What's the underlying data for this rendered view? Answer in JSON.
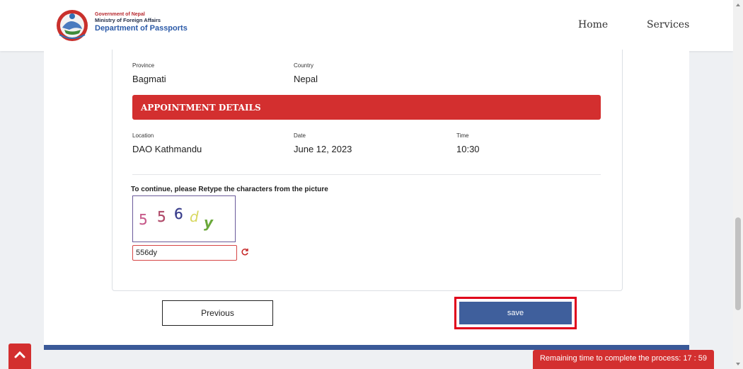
{
  "header": {
    "org_line1": "Government of Nepal",
    "org_line2": "Ministry of Foreign Affairs",
    "org_line3": "Department of Passports",
    "nav": [
      {
        "label": "Home"
      },
      {
        "label": "Services"
      }
    ]
  },
  "address": {
    "province_label": "Province",
    "province_value": "Bagmati",
    "country_label": "Country",
    "country_value": "Nepal"
  },
  "appointment": {
    "section_title": "APPOINTMENT DETAILS",
    "location_label": "Location",
    "location_value": "DAO Kathmandu",
    "date_label": "Date",
    "date_value": "June 12, 2023",
    "time_label": "Time",
    "time_value": "10:30"
  },
  "captcha": {
    "prompt": "To continue, please Retype the characters from the picture",
    "image_text": "556dy",
    "input_value": "556dy"
  },
  "actions": {
    "previous_label": "Previous",
    "save_label": "save"
  },
  "timer": {
    "label": "Remaining time to complete the process: 17 : 59"
  },
  "colors": {
    "accent_red": "#d32f2f",
    "save_blue": "#3f5f9c",
    "highlight_red": "#e0001b"
  }
}
